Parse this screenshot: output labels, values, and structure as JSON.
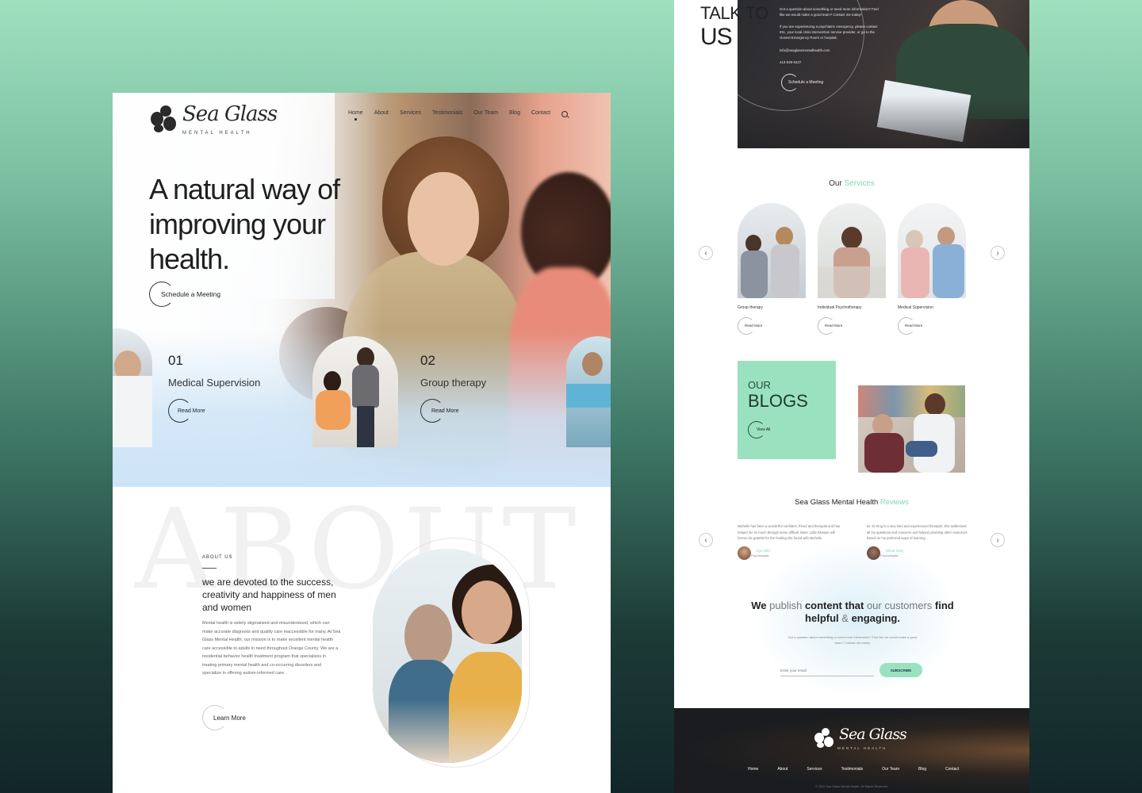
{
  "left": {
    "logo": {
      "script": "Sea Glass",
      "tag": "MENTAL HEALTH"
    },
    "nav": [
      "Home",
      "About",
      "Services",
      "Testimonials",
      "Our Team",
      "Blog",
      "Contact"
    ],
    "nav_active": "Home",
    "hero": {
      "title_line1": "A natural way of",
      "title_line2": "improving your",
      "title_line3": "health.",
      "cta": "Schedule a Meeting"
    },
    "service_cards": [
      {
        "num": "01",
        "name": "Medical Supervision",
        "cta": "Read More"
      },
      {
        "num": "02",
        "name": "Group therapy",
        "cta": "Read More"
      }
    ],
    "about": {
      "ghost": "ABOUT",
      "eyebrow": "ABOUT US",
      "heading": "we are devoted to the success, creativity and happiness of men and women",
      "body": "Mental health is widely stigmatized and misunderstood, which can make accurate diagnosis and quality care inaccessible for many. At Sea Glass Mental Health, our mission is to make excellent mental health care accessible to adults in need throughout Orange County. We are a residential behavior health treatment program that specializes in treating primary mental health and co-occurring disorders and specialize in offering autism-informed care.",
      "cta": "Learn More"
    }
  },
  "right": {
    "talk": {
      "line1": "TALK TO",
      "line2": "US",
      "p1": "Got a question about something or need more information? Feel like we would make a good team? Contact me today!",
      "p2": "If you are experiencing a psychiatric emergency, please contact 911, your local crisis intervention service provider, or go to the closest Emergency Room or hospital.",
      "email": "info@seaglassmentalhealth.com",
      "phone": "413-929-0427",
      "cta": "Schedule a Meeting"
    },
    "services": {
      "heading_a": "Our ",
      "heading_b": "Services",
      "items": [
        {
          "name": "Group therapy",
          "cta": "Read More"
        },
        {
          "name": "Individual Psychotherapy",
          "cta": "Read More"
        },
        {
          "name": "Medical Supervision",
          "cta": "Read More"
        }
      ]
    },
    "blogs": {
      "line1": "OUR",
      "line2": "BLOGS",
      "cta": "View All"
    },
    "reviews": {
      "heading_a": "Sea Glass Mental Health ",
      "heading_b": "Reviews",
      "items": [
        {
          "text": "Michelle has been a wonderful confident, friend and therapist and has helped me so much through some difficult times. Little Ekwase will forever be grateful for the healing she found with Michelle.",
          "name": "Kyn Hills",
          "role": "Psychologist"
        },
        {
          "text": "Dr. Di King is a very kind and experienced therapist. She addressed all my questions and concerns and helped providing other resources based on my preferred ways of learning.",
          "name": "Olivia Grey",
          "role": "Psychologist"
        }
      ]
    },
    "publish": {
      "w1": "We",
      "w2": " publish ",
      "w3": "content that",
      "w4": " our customers ",
      "w5": "find",
      "w6": "helpful",
      "w7": " & ",
      "w8": "engaging.",
      "sub": "Got a question about something or need more information? Feel like we would make a good team? Contact me today!",
      "placeholder": "Enter your email",
      "button": "SUBSCRIBE"
    },
    "footer": {
      "logo_script": "Sea Glass",
      "logo_tag": "MENTAL HEALTH",
      "links": [
        "Home",
        "About",
        "Services",
        "Testimonials",
        "Our Team",
        "Blog",
        "Contact"
      ],
      "copyright": "© 2022 Sea Glass Mental Health. All Rights Reserved."
    }
  },
  "colors": {
    "accent_green": "#9ae2bf",
    "hero_blue": "#cde4f7"
  }
}
